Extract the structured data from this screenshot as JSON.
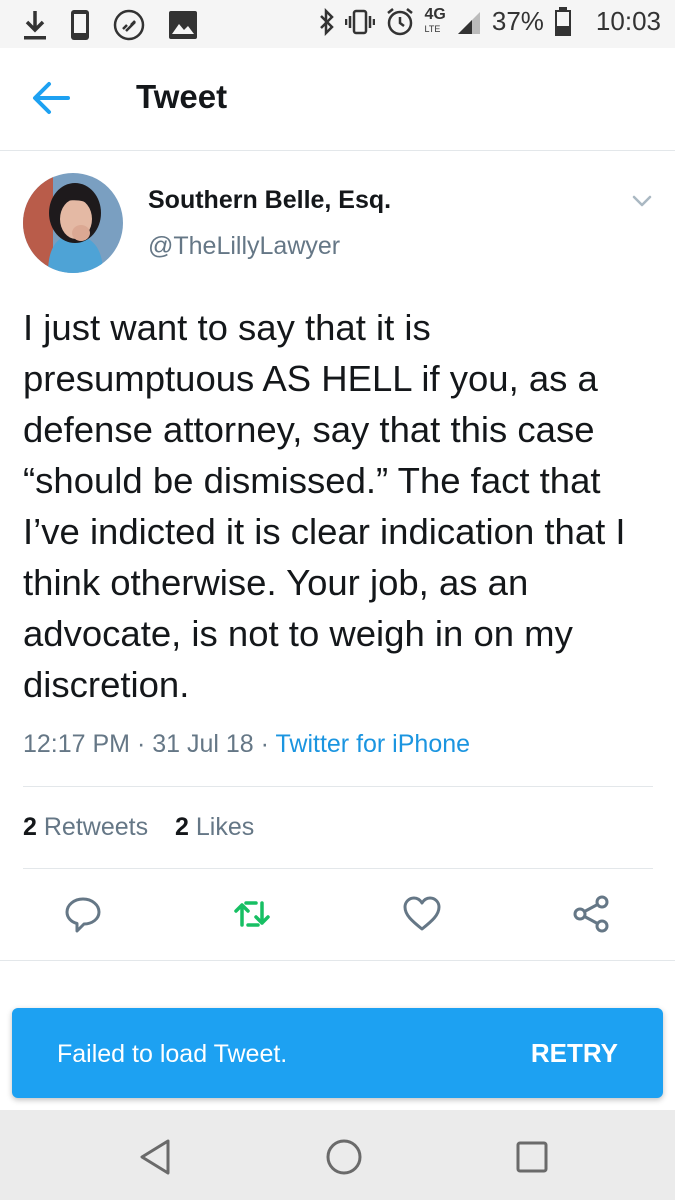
{
  "status_bar": {
    "network": "4G",
    "network_sub": "LTE",
    "battery": "37%",
    "time": "10:03"
  },
  "header": {
    "title": "Tweet",
    "back_icon": "back-arrow-icon"
  },
  "tweet": {
    "display_name": "Southern Belle, Esq.",
    "handle": "@TheLillyLawyer",
    "text": "I just want to say that it is presumptuous AS HELL if you, as a defense attorney, say that this case “should be dismissed.” The fact that I’ve indicted it is clear indication that I think otherwise. Your job, as an advocate, is not to weigh in on my discretion.",
    "time": "12:17 PM",
    "date": "31 Jul 18",
    "separator": "·",
    "source": "Twitter for iPhone",
    "retweets_count": "2",
    "retweets_label": "Retweets",
    "likes_count": "2",
    "likes_label": "Likes"
  },
  "actions": {
    "reply_icon": "reply-icon",
    "retweet_icon": "retweet-icon",
    "like_icon": "heart-icon",
    "share_icon": "share-icon",
    "retweet_color": "#17bf63",
    "icon_color": "#657786"
  },
  "snackbar": {
    "message": "Failed to load Tweet.",
    "action": "RETRY",
    "background": "#1da1f2"
  },
  "colors": {
    "accent": "#1da1f2",
    "text": "#14171a",
    "secondary": "#657786",
    "link": "#1b95e0"
  }
}
